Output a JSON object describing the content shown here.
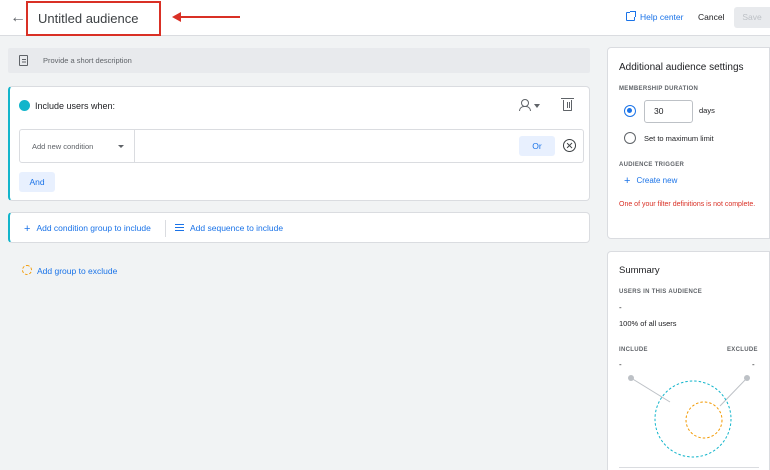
{
  "header": {
    "title": "Untitled audience",
    "help_label": "Help center",
    "cancel_label": "Cancel",
    "save_label": "Save"
  },
  "description": {
    "placeholder": "Provide a short description"
  },
  "include_group": {
    "title": "Include users when:",
    "condition_placeholder": "Add new condition",
    "or_label": "Or",
    "and_label": "And"
  },
  "actions": {
    "add_condition_group": "Add condition group to include",
    "add_sequence": "Add sequence to include",
    "add_exclude": "Add group to exclude"
  },
  "settings": {
    "title": "Additional audience settings",
    "membership_caption": "MEMBERSHIP DURATION",
    "days_value": "30",
    "days_label": "days",
    "max_limit_label": "Set to maximum limit",
    "trigger_caption": "AUDIENCE TRIGGER",
    "create_new": "Create new",
    "error": "One of your filter definitions is not complete."
  },
  "summary": {
    "title": "Summary",
    "users_caption": "USERS IN THIS AUDIENCE",
    "users_value": "-",
    "percent": "100% of all users",
    "include_caption": "INCLUDE",
    "exclude_caption": "EXCLUDE",
    "include_value": "-",
    "exclude_value": "-"
  },
  "colors": {
    "accent": "#1a73e8",
    "include": "#12b5cb",
    "exclude": "#f29900",
    "error": "#d93025",
    "annotation": "#d93025"
  }
}
